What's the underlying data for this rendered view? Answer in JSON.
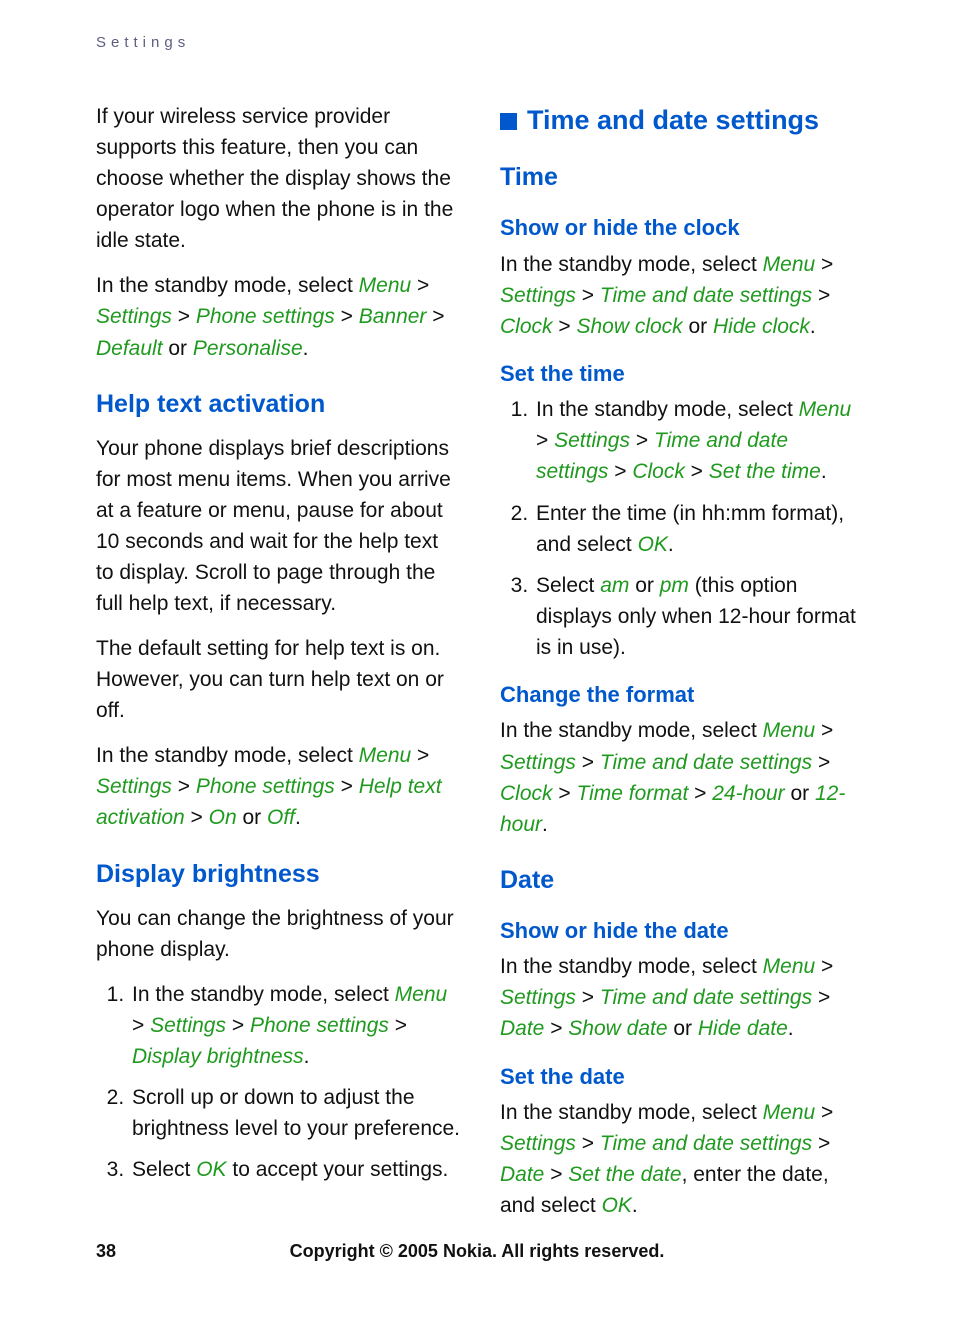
{
  "running_head": "Settings",
  "left": {
    "intro_para": "If your wireless service provider supports this feature, then you can choose whether the display shows the operator logo when the phone is in the idle state.",
    "intro_path_prefix": "In the standby mode, select ",
    "intro_path_menu": "Menu",
    "gt": " > ",
    "intro_path_settings": "Settings",
    "intro_path_phone": "Phone settings",
    "intro_path_banner": "Banner",
    "intro_path_default": "Default",
    "or": " or ",
    "intro_path_personalise": "Personalise",
    "period": ".",
    "help_heading": "Help text activation",
    "help_para1": "Your phone displays brief descriptions for most menu items. When you arrive at a feature or menu, pause for about 10 seconds and wait for the help text to display. Scroll to page through the full help text, if necessary.",
    "help_para2": "The default setting for help text is on. However, you can turn help text on or off.",
    "help_path_menu": "Menu",
    "help_path_settings": "Settings",
    "help_path_phone": "Phone settings",
    "help_path_hta": "Help text activation",
    "help_path_on": "On",
    "help_path_off": "Off",
    "bright_heading": "Display brightness",
    "bright_para": "You can change the brightness of your phone display.",
    "bright_li1_prefix": "In the standby mode, select ",
    "bright_li1_menu": "Menu",
    "bright_li1_settings": "Settings",
    "bright_li1_phone": "Phone settings",
    "bright_li1_db": "Display brightness",
    "bright_li2": "Scroll up or down to adjust the brightness level to your preference.",
    "bright_li3_prefix": "Select ",
    "bright_li3_ok": "OK",
    "bright_li3_suffix": " to accept your settings."
  },
  "right": {
    "top_heading": "Time and date settings",
    "time_heading": "Time",
    "clock_h": "Show or hide the clock",
    "clock_prefix": "In the standby mode, select ",
    "m_menu": "Menu",
    "m_settings": "Settings",
    "m_tds": "Time and date settings",
    "m_clock": "Clock",
    "m_showclock": "Show clock",
    "m_hideclock": "Hide clock",
    "settime_h": "Set the time",
    "settime_li1_prefix": "In the standby mode, select ",
    "settime_li1_stt": "Set the time",
    "settime_li2_prefix": "Enter the time (in hh:mm format), and select ",
    "settime_li2_ok": "OK",
    "settime_li3_prefix": "Select ",
    "settime_li3_am": "am",
    "settime_li3_pm": "pm",
    "settime_li3_suffix": " (this option displays only when 12-hour format is in use).",
    "fmt_h": "Change the format",
    "fmt_tf": "Time format",
    "fmt_24": "24-hour",
    "fmt_12": "12-hour",
    "date_heading": "Date",
    "showdate_h": "Show or hide the date",
    "m_date": "Date",
    "m_showdate": "Show date",
    "m_hidedate": "Hide date",
    "setdate_h": "Set the date",
    "setdate_std": "Set the date",
    "setdate_suffix": ", enter the date, and select ",
    "setdate_ok": "OK"
  },
  "footer": {
    "page": "38",
    "copyright": "Copyright © 2005 Nokia. All rights reserved."
  }
}
